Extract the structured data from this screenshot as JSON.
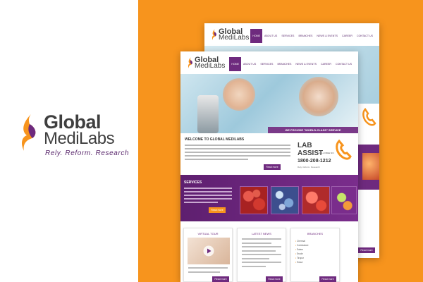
{
  "brand": {
    "name_line1": "Global",
    "name_line2": "MediLabs",
    "tagline": "Rely. Reform. Research",
    "colors": {
      "orange": "#f7941d",
      "purple": "#6e2a7e",
      "gray": "#3f3f3f"
    }
  },
  "nav": {
    "items": [
      "HOME",
      "ABOUT US",
      "SERVICES",
      "BRANCHES",
      "NEWS & EVENTS",
      "CAREER",
      "CONTACT US"
    ],
    "active": "HOME"
  },
  "hero": {
    "caption": "WE PROVIDE \"WORLD-CLASS\" SERVICE"
  },
  "welcome": {
    "title": "WELCOME TO GLOBAL MEDILABS",
    "button": "Read more"
  },
  "lab_assist": {
    "line1": "LAB",
    "line2": "ASSIST",
    "call_text": "CALL FREE NO.",
    "phone": "1800-208-1212",
    "tagline": "Rely. Reform. Research"
  },
  "services": {
    "title": "SERVICES",
    "button": "Read more"
  },
  "columns": [
    {
      "title": "VIRTUAL TOUR",
      "button": "Read more"
    },
    {
      "title": "LATEST NEWS",
      "button": "Read more"
    },
    {
      "title": "BRANCHES",
      "button": "Read more"
    }
  ],
  "branches": [
    "Chennai",
    "Coimbatore",
    "Salem",
    "Erode",
    "Tirupur",
    "Hosur"
  ]
}
